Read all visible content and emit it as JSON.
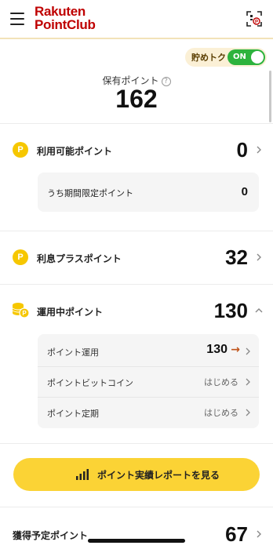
{
  "header": {
    "logo_line1": "Rakuten",
    "logo_line2": "PointClub",
    "menu_icon": "hamburger-icon",
    "scan_icon": "qr-scan-icon"
  },
  "save_toggle": {
    "label": "貯めトク",
    "state": "ON"
  },
  "holding": {
    "label": "保有ポイント",
    "help": "?",
    "value": "162"
  },
  "available": {
    "label": "利用可能ポイント",
    "value": "0",
    "icon_letter": "P",
    "limited": {
      "label": "うち期間限定ポイント",
      "value": "0"
    }
  },
  "interest": {
    "label": "利息プラスポイント",
    "value": "32",
    "icon_letter": "P"
  },
  "operating": {
    "label": "運用中ポイント",
    "value": "130",
    "items": [
      {
        "label": "ポイント運用",
        "value": "130",
        "trend": "→"
      },
      {
        "label": "ポイントビットコイン",
        "value": "はじめる"
      },
      {
        "label": "ポイント定期",
        "value": "はじめる"
      }
    ]
  },
  "report_button": {
    "label": "ポイント実績レポートを見る"
  },
  "upcoming": {
    "label": "獲得予定ポイント",
    "value": "67"
  },
  "colors": {
    "brand": "#bf0000",
    "accent_yellow": "#fbd335",
    "toggle_green": "#2db33d",
    "trend_arrow": "#c0541b"
  }
}
